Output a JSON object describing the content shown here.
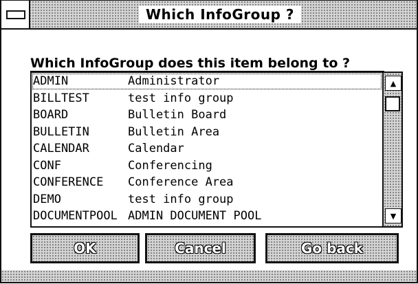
{
  "window": {
    "title": "Which InfoGroup ?"
  },
  "prompt": "Which InfoGroup does this item belong to ?",
  "list": {
    "items": [
      {
        "code": "ADMIN",
        "description": "Administrator",
        "selected": true
      },
      {
        "code": "BILLTEST",
        "description": "test info group",
        "selected": false
      },
      {
        "code": "BOARD",
        "description": "Bulletin Board",
        "selected": false
      },
      {
        "code": "BULLETIN",
        "description": "Bulletin Area",
        "selected": false
      },
      {
        "code": "CALENDAR",
        "description": "Calendar",
        "selected": false
      },
      {
        "code": "CONF",
        "description": "Conferencing",
        "selected": false
      },
      {
        "code": "CONFERENCE",
        "description": "Conference Area",
        "selected": false
      },
      {
        "code": "DEMO",
        "description": "test info group",
        "selected": false
      },
      {
        "code": "DOCUMENTPOOL",
        "description": "ADMIN DOCUMENT POOL",
        "selected": false
      }
    ]
  },
  "scrollbar": {
    "up_icon": "▲",
    "down_icon": "▼"
  },
  "buttons": {
    "ok": "OK",
    "cancel": "Cancel",
    "go_back": "Go back"
  }
}
